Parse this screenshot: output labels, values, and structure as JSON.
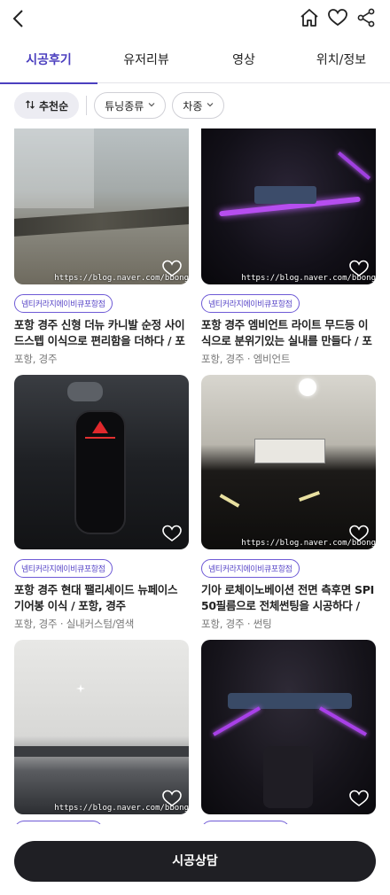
{
  "header": {
    "back_icon": "chevron-left-icon",
    "icons": [
      "home-icon",
      "heart-icon",
      "share-icon"
    ]
  },
  "tabs": [
    {
      "label": "시공후기",
      "active": true
    },
    {
      "label": "유저리뷰",
      "active": false
    },
    {
      "label": "영상",
      "active": false
    },
    {
      "label": "위치/정보",
      "active": false
    }
  ],
  "filters": {
    "sort_label": "추천순",
    "sort_icon": "sort-arrows-icon",
    "tuning_label": "튜닝종류",
    "car_label": "차종"
  },
  "posts": [
    {
      "tag": "넴티커라지에이비큐포항점",
      "title": "포항 경주 신형 더뉴 카니발 순정 사이드스텝 이식으로 편리함을 더하다 / 포항...",
      "meta": "포항, 경주",
      "watermark": "https://blog.naver.com/bbong"
    },
    {
      "tag": "넴티커라지에이비큐포항점",
      "title": "포항 경주 엠비언트 라이트 무드등 이식으로 분위기있는 실내를 만들다 / 포항...",
      "meta": "포항, 경주 · 엠비언트",
      "watermark": "https://blog.naver.com/bbong"
    },
    {
      "tag": "넴티커라지에이비큐포항점",
      "title": "포항 경주 현대 팰리세이드 뉴페이스 기어봉 이식 / 포항, 경주",
      "meta": "포항, 경주 · 실내커스텀/염색",
      "watermark": ""
    },
    {
      "tag": "넴티커라지에이비큐포항점",
      "title": "기아 로체이노베이션 전면 측후면 SPI 50필름으로 전체썬팅을 시공하다 / 포...",
      "meta": "포항, 경주 · 썬팅",
      "watermark": "https://blog.naver.com/bbong"
    },
    {
      "tag": "",
      "title": "",
      "meta": "",
      "watermark": "https://blog.naver.com/bbong"
    },
    {
      "tag": "",
      "title": "",
      "meta": "",
      "watermark": ""
    }
  ],
  "cta": {
    "label": "시공상담"
  },
  "colors": {
    "accent": "#4b3fbf",
    "tag_border": "#6e5ad6",
    "cta_bg": "#1f1f24"
  }
}
